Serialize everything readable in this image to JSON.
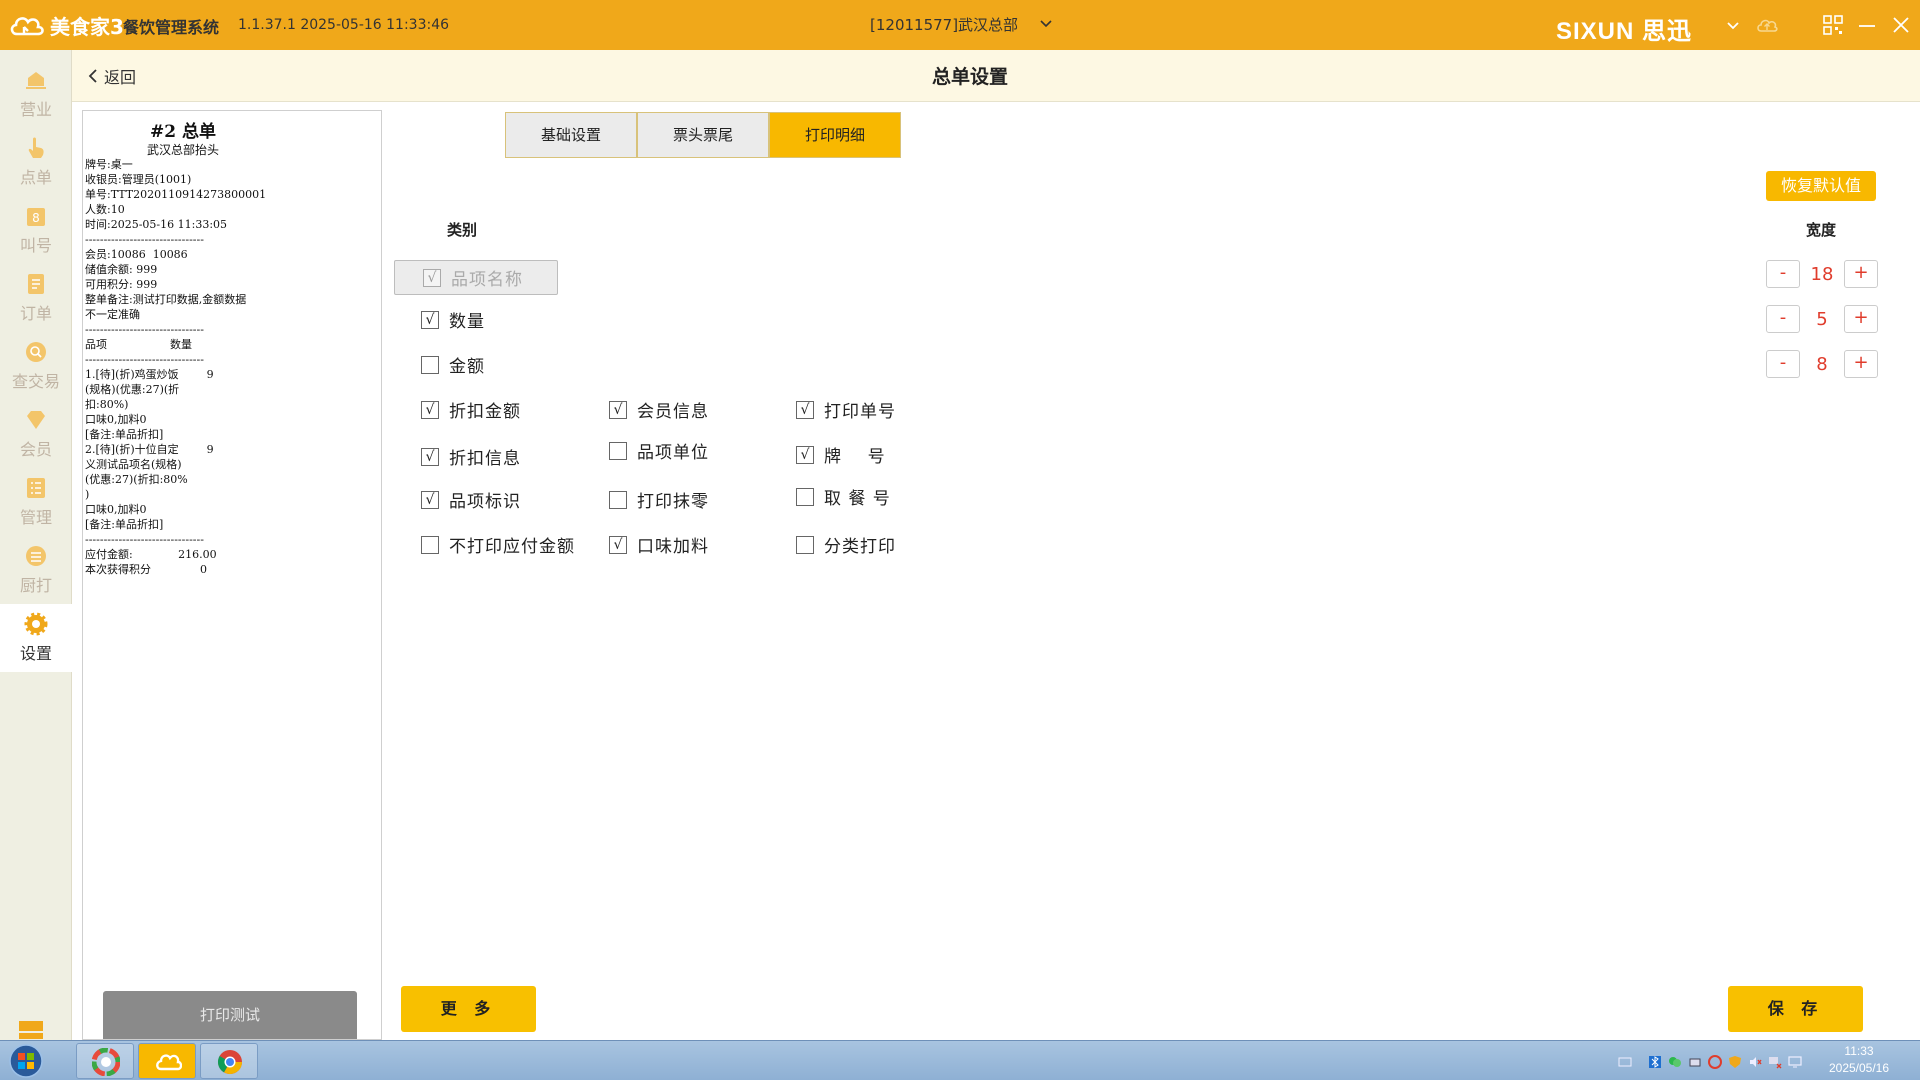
{
  "titlebar": {
    "app_name": "美食家3",
    "system_name": "餐饮管理系统",
    "version": "1.1.37.1 2025-05-16 11:33:46",
    "store": "[12011577]武汉总部",
    "brand": "SIXUN 思迅"
  },
  "sidebar": {
    "items": [
      {
        "label": "营业",
        "icon": "business-icon"
      },
      {
        "label": "点单",
        "icon": "order-icon"
      },
      {
        "label": "叫号",
        "icon": "call-number-icon"
      },
      {
        "label": "订单",
        "icon": "orders-icon"
      },
      {
        "label": "查交易",
        "icon": "transaction-icon"
      },
      {
        "label": "会员",
        "icon": "member-icon"
      },
      {
        "label": "管理",
        "icon": "manage-icon"
      },
      {
        "label": "厨打",
        "icon": "kitchen-print-icon"
      },
      {
        "label": "设置",
        "icon": "settings-icon",
        "active": true
      }
    ]
  },
  "header": {
    "back_label": "返回",
    "title": "总单设置"
  },
  "preview": {
    "title": "#2 总单",
    "subtitle": "武汉总部抬头",
    "lines": [
      "牌号:桌一",
      "收银员:管理员(1001)",
      "单号:TTT2020110914273800001",
      "人数:10",
      "时间:2025-05-16 11:33:05",
      "--------------------------------",
      "会员:10086  10086",
      "储值余额: 999",
      "可用积分: 999",
      "整单备注:测试打印数据,金额数据",
      "不一定准确",
      "--------------------------------",
      "品项                  数量",
      "--------------------------------",
      "1.[待](折)鸡蛋炒饭        9",
      "(规格)(优惠:27)(折",
      "扣:80%)",
      "口味0,加料0",
      "[备注:单品折扣]",
      "2.[待](折)十位自定        9",
      "义测试品项名(规格)",
      "(优惠:27)(折扣:80%",
      ")",
      "口味0,加料0",
      "[备注:单品折扣]",
      "--------------------------------",
      "应付金额:             216.00",
      "本次获得积分              0"
    ],
    "print_test_label": "打印测试"
  },
  "tabs": [
    {
      "label": "基础设置",
      "active": false
    },
    {
      "label": "票头票尾",
      "active": false
    },
    {
      "label": "打印明细",
      "active": true
    }
  ],
  "restore_default_label": "恢复默认值",
  "category_header": "类别",
  "width_header": "宽度",
  "checkboxes": {
    "item_name": {
      "label": "品项名称",
      "checked": true,
      "disabled": true
    },
    "quantity": {
      "label": "数量",
      "checked": true
    },
    "amount": {
      "label": "金额",
      "checked": false
    },
    "discount_amount": {
      "label": "折扣金额",
      "checked": true
    },
    "member_info": {
      "label": "会员信息",
      "checked": true
    },
    "print_order_no": {
      "label": "打印单号",
      "checked": true
    },
    "discount_info": {
      "label": "折扣信息",
      "checked": true
    },
    "item_unit": {
      "label": "品项单位",
      "checked": false
    },
    "table_no": {
      "label": "牌    号",
      "checked": true
    },
    "item_mark": {
      "label": "品项标识",
      "checked": true
    },
    "print_rounding": {
      "label": "打印抹零",
      "checked": false
    },
    "pickup_no": {
      "label": "取 餐 号",
      "checked": false
    },
    "no_print_payable": {
      "label": "不打印应付金额",
      "checked": false
    },
    "taste_addon": {
      "label": "口味加料",
      "checked": true
    },
    "category_print": {
      "label": "分类打印",
      "checked": false
    }
  },
  "check_mark": "√",
  "widths": [
    {
      "minus": "-",
      "value": "18",
      "plus": "+"
    },
    {
      "minus": "-",
      "value": "5",
      "plus": "+"
    },
    {
      "minus": "-",
      "value": "8",
      "plus": "+"
    }
  ],
  "more_label": "更 多",
  "save_label": "保 存",
  "taskbar": {
    "time": "11:33",
    "date": "2025/05/16"
  },
  "colors": {
    "accent": "#f0a81a",
    "button": "#f8c000",
    "stepper_text": "#e03c2c"
  }
}
